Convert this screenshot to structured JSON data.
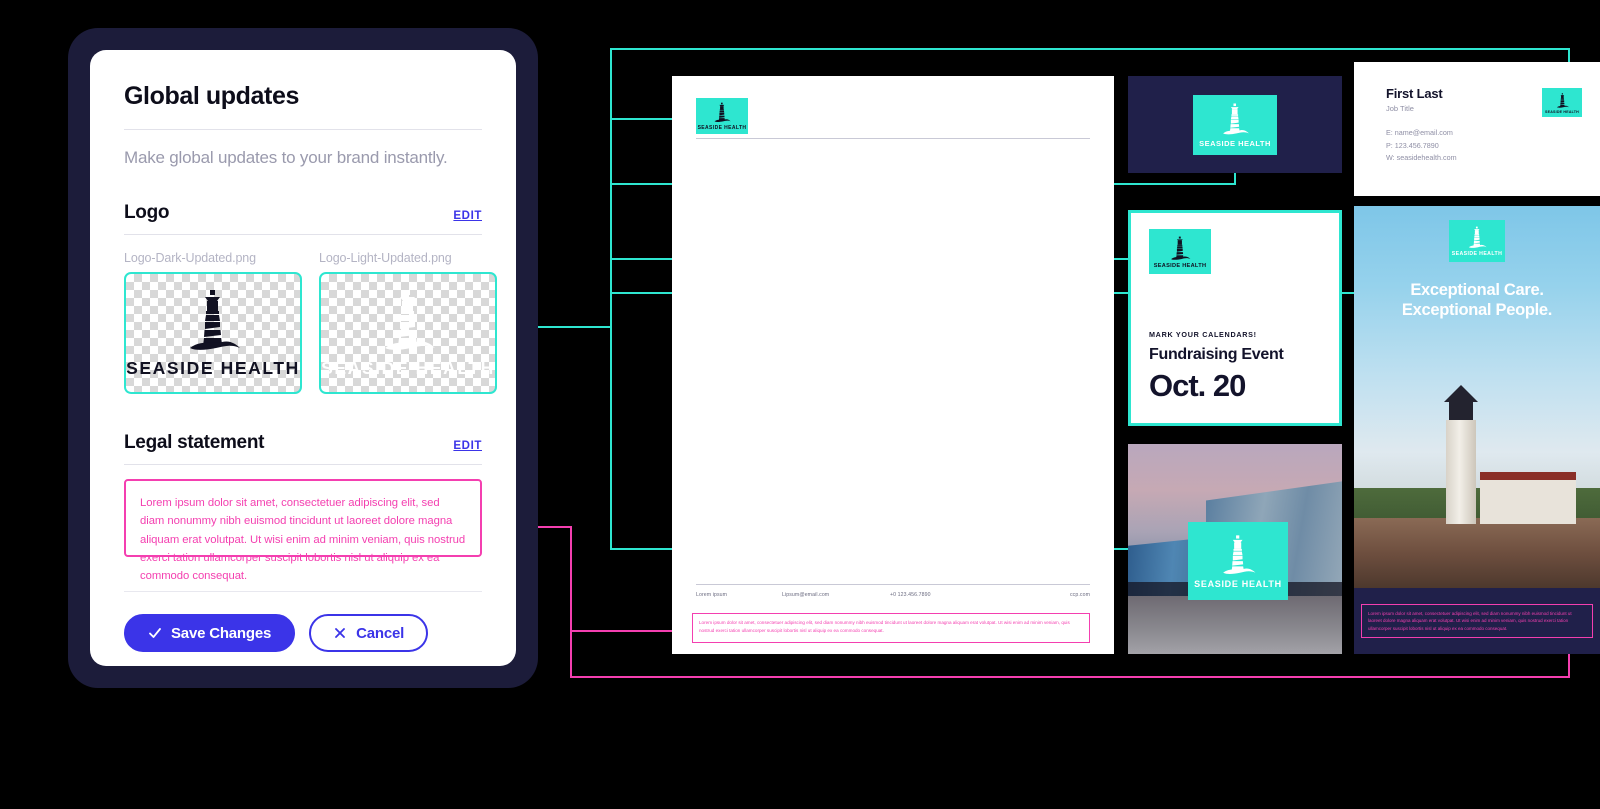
{
  "panel": {
    "title": "Global updates",
    "subtitle": "Make global updates to your brand instantly.",
    "logo_section": {
      "title": "Logo",
      "edit_label": "EDIT",
      "files": [
        {
          "filename": "Logo-Dark-Updated.png",
          "variant": "dark"
        },
        {
          "filename": "Logo-Light-Updated.png",
          "variant": "light"
        }
      ]
    },
    "legal_section": {
      "title": "Legal statement",
      "edit_label": "EDIT",
      "text": "Lorem ipsum dolor sit amet, consectetuer adipiscing elit, sed diam nonummy nibh euismod tincidunt ut laoreet dolore magna aliquam erat volutpat. Ut wisi enim ad minim veniam, quis nostrud exerci tation ullamcorper suscipit lobortis nisl ut aliquip ex ea commodo consequat."
    },
    "actions": {
      "save_label": "Save Changes",
      "cancel_label": "Cancel",
      "save_icon": "check-icon",
      "cancel_icon": "close-icon"
    }
  },
  "brand": {
    "name": "SEASIDE HEALTH",
    "mark": "lighthouse-icon"
  },
  "assets": {
    "letterhead": {
      "footer": {
        "company": "Lorem ipsum",
        "email": "Lipsum@email.com",
        "phone": "+0 123.456.7890",
        "website": "ccp.com"
      },
      "legal": "Lorem ipsum dolor sit amet, consectetuer adipiscing elit, sed diam nonummy nibh euismod tincidunt ut laoreet dolore magna aliquam erat volutpat. Ut wisi enim ad minim veniam, quis nostrud exerci tation ullamcorper suscipit lobortis nisl ut aliquip ex ea commodo consequat."
    },
    "business_card": {
      "name": "First Last",
      "job_title": "Job Title",
      "email_line": "E: name@email.com",
      "phone_line": "P: 123.456.7890",
      "web_line": "W: seasidehealth.com"
    },
    "event_flyer": {
      "kicker": "MARK YOUR CALENDARS!",
      "headline": "Fundraising Event",
      "date": "Oct. 20"
    },
    "hero_poster": {
      "headline_line1": "Exceptional Care.",
      "headline_line2": "Exceptional People.",
      "legal": "Lorem ipsum dolor sit amet, consectetuer adipiscing elit, sed diam nonummy nibh euismod tincidunt ut laoreet dolore magna aliquam erat volutpat. Ut wisi enim ad minim veniam, quis nostrud exerci tation ullamcorper suscipit lobortis nisl ut aliquip ex ea commodo consequat."
    }
  },
  "colors": {
    "background": "#000000",
    "accent_cyan": "#2ee6d0",
    "accent_magenta": "#f43fb0",
    "brand_indigo": "#3b34e8",
    "device_frame": "#1c1c3a",
    "dark_navy": "#20204a"
  }
}
